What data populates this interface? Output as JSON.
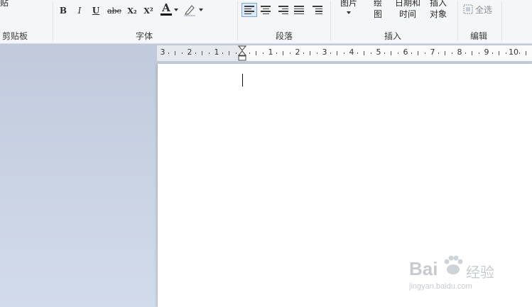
{
  "ribbon": {
    "paste_fragment": "贴",
    "clipboard_label": "剪贴板",
    "font_label": "字体",
    "paragraph_label": "段落",
    "insert_label": "插入",
    "edit_label": "编辑",
    "bold": "B",
    "italic": "I",
    "underline": "U",
    "strike": "abe",
    "subscript": "X₂",
    "superscript": "X²",
    "font_color": "A",
    "picture": "图片",
    "drawing_top": "绘",
    "drawing_bottom": "图",
    "datetime_top": "日期和",
    "datetime_bottom": "时间",
    "object_top": "插入",
    "object_bottom": "对象",
    "select_all": "全选"
  },
  "ruler": {
    "left_numbers": [
      "3",
      "2",
      "1"
    ],
    "right_numbers": [
      "1",
      "2",
      "3",
      "4",
      "5",
      "6",
      "7",
      "8",
      "9",
      "10"
    ]
  },
  "watermark": {
    "brand": "Bai",
    "brand_tail": "经验",
    "url": "jingyan.baidu.com"
  }
}
